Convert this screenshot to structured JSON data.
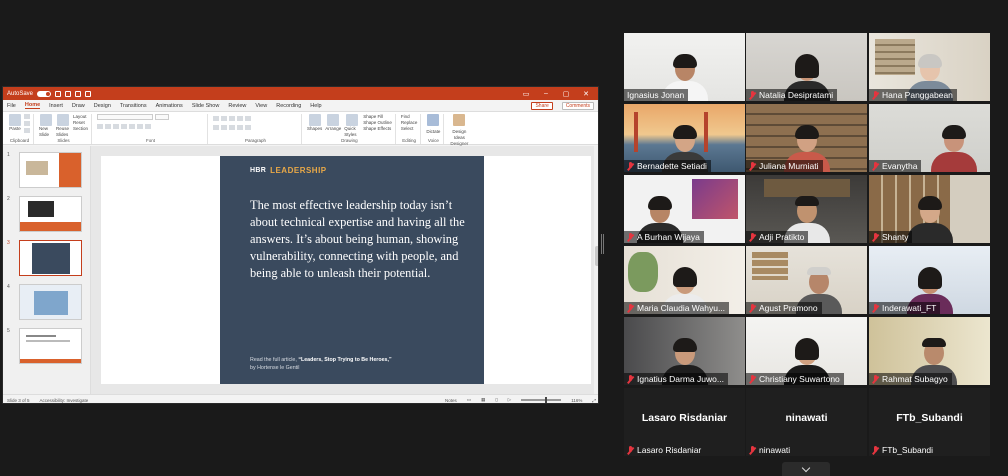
{
  "ppt": {
    "autosave_label": "AutoSave",
    "autosave_state": "Off",
    "tabs": [
      {
        "label": "File"
      },
      {
        "label": "Home"
      },
      {
        "label": "Insert"
      },
      {
        "label": "Draw"
      },
      {
        "label": "Design"
      },
      {
        "label": "Transitions"
      },
      {
        "label": "Animations"
      },
      {
        "label": "Slide Show"
      },
      {
        "label": "Review"
      },
      {
        "label": "View"
      },
      {
        "label": "Recording"
      },
      {
        "label": "Help"
      }
    ],
    "active_tab": "Home",
    "share_label": "Share",
    "comments_label": "Comments",
    "ribbon": {
      "clipboard": "Clipboard",
      "paste": "Paste",
      "slides": "Slides",
      "new_slide": "New Slide",
      "reuse_slides": "Reuse Slides",
      "layout": "Layout",
      "reset": "Reset",
      "section": "Section",
      "font": "Font",
      "paragraph": "Paragraph",
      "drawing": "Drawing",
      "shapes": "Shapes",
      "arrange": "Arrange",
      "quick_styles": "Quick Styles",
      "shape_fill": "Shape Fill",
      "shape_outline": "Shape Outline",
      "shape_effects": "Shape Effects",
      "editing": "Editing",
      "find": "Find",
      "replace": "Replace",
      "select": "Select",
      "voice": "Voice",
      "dictate": "Dictate",
      "designer": "Designer",
      "design_ideas": "Design Ideas"
    },
    "thumbnails": [
      "1",
      "2",
      "3",
      "4",
      "5"
    ],
    "selected_slide": 3,
    "slide": {
      "brand": "HBR",
      "section": "LEADERSHIP",
      "quote": "The most effective leadership today isn’t about technical expertise and having all the answers. It’s about being human, showing vulnerability, connecting with people, and being able to unleash their potential.",
      "footer_prefix": "Read the full article,",
      "footer_title": "“Leaders, Stop Trying to Be Heroes,”",
      "footer_author": "by Hortense le Gentil"
    },
    "status": {
      "slide_counter": "Slide 3 of 5",
      "accessibility": "Accessibility: Investigate",
      "notes": "Notes",
      "zoom": "116%"
    },
    "colors": {
      "accent": "#c43e1c",
      "slide_bg": "#3a4a5e",
      "leadership": "#e8a847"
    }
  },
  "gallery": [
    {
      "name": "Ignasius Jonan",
      "muted": false,
      "active": true,
      "has_video": true
    },
    {
      "name": "Natalia Desipratami",
      "muted": true,
      "has_video": true
    },
    {
      "name": "Hana Panggabean",
      "muted": true,
      "has_video": true
    },
    {
      "name": "Bernadette Setiadi",
      "muted": true,
      "has_video": true
    },
    {
      "name": "Juliana Murniati",
      "muted": true,
      "has_video": true
    },
    {
      "name": "Evanytha",
      "muted": true,
      "has_video": true
    },
    {
      "name": "A Burhan Wijaya",
      "muted": true,
      "has_video": true
    },
    {
      "name": "Adji Pratikto",
      "muted": true,
      "has_video": true
    },
    {
      "name": "Shanty",
      "muted": true,
      "has_video": true
    },
    {
      "name": "Maria Claudia Wahyu...",
      "muted": true,
      "has_video": true
    },
    {
      "name": "Agust Pramono",
      "muted": true,
      "has_video": true
    },
    {
      "name": "Inderawati_FT",
      "muted": true,
      "has_video": true
    },
    {
      "name": "Ignatius Darma Juwo...",
      "muted": true,
      "has_video": true
    },
    {
      "name": "Christiany Suwartono",
      "muted": true,
      "has_video": true
    },
    {
      "name": "Rahmat Subagyo",
      "muted": true,
      "has_video": true
    },
    {
      "name": "Lasaro Risdaniar",
      "display": "Lasaro Risdaniar",
      "muted": true,
      "has_video": false
    },
    {
      "name": "ninawati",
      "display": "ninawati",
      "muted": true,
      "has_video": false
    },
    {
      "name": "FTb_Subandi",
      "display": "FTb_Subandi",
      "muted": true,
      "has_video": false
    }
  ]
}
